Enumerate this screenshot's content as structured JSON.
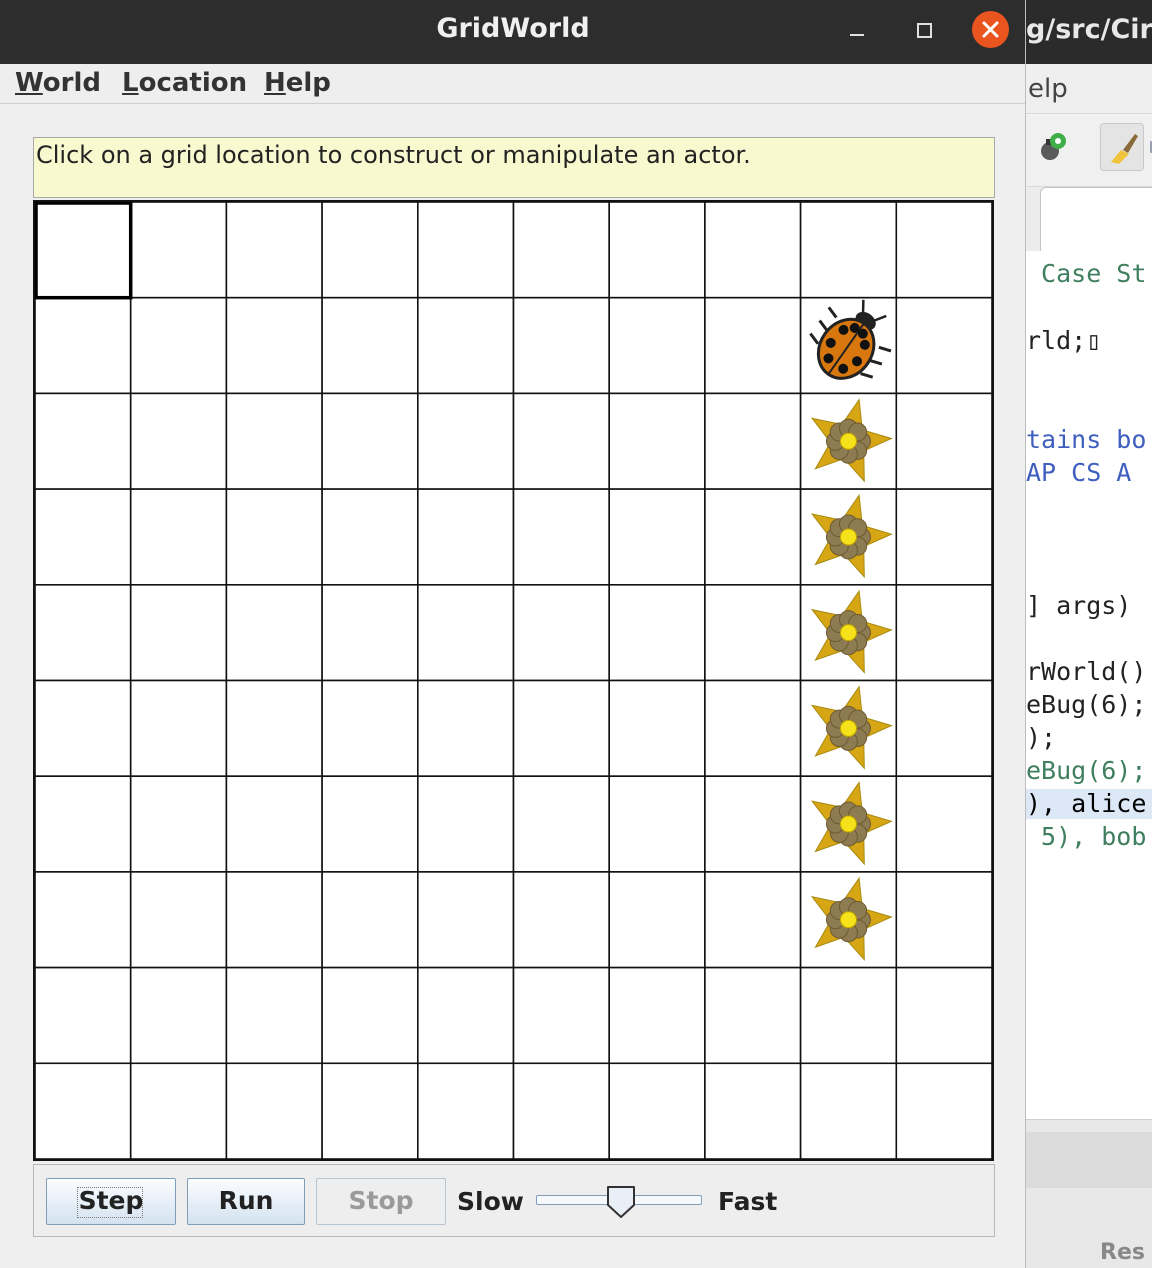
{
  "window": {
    "title": "GridWorld"
  },
  "menu": {
    "world": {
      "mnemonic": "W",
      "rest": "orld"
    },
    "location": {
      "mnemonic": "L",
      "rest": "ocation"
    },
    "help": {
      "mnemonic": "H",
      "rest": "elp"
    }
  },
  "message": "Click on a grid location to construct or manipulate an actor.",
  "grid": {
    "rows": 10,
    "cols": 10,
    "selected": {
      "row": 0,
      "col": 0
    },
    "actors": [
      {
        "type": "bug",
        "icon": "ladybug-icon",
        "row": 1,
        "col": 8
      },
      {
        "type": "flower",
        "icon": "flower-icon",
        "row": 2,
        "col": 8
      },
      {
        "type": "flower",
        "icon": "flower-icon",
        "row": 3,
        "col": 8
      },
      {
        "type": "flower",
        "icon": "flower-icon",
        "row": 4,
        "col": 8
      },
      {
        "type": "flower",
        "icon": "flower-icon",
        "row": 5,
        "col": 8
      },
      {
        "type": "flower",
        "icon": "flower-icon",
        "row": 6,
        "col": 8
      },
      {
        "type": "flower",
        "icon": "flower-icon",
        "row": 7,
        "col": 8
      }
    ]
  },
  "controls": {
    "step_label": "Step",
    "run_label": "Run",
    "stop_label": "Stop",
    "slow_label": "Slow",
    "fast_label": "Fast",
    "speed_level": 0.5
  },
  "background_editor": {
    "title_fragment": "g/src/Cir",
    "menu_fragment": "elp",
    "code_lines": [
      {
        "text": " Case St",
        "style": "comment"
      },
      {
        "text": "rld;▯",
        "style": "plain"
      },
      {
        "text": "tains bo",
        "style": "doc"
      },
      {
        "text": "AP CS A",
        "style": "doc"
      },
      {
        "text": "] args)",
        "style": "plain"
      },
      {
        "text": "rWorld()",
        "style": "plain"
      },
      {
        "text": "eBug(6);",
        "style": "plain"
      },
      {
        "text": ");",
        "style": "plain"
      },
      {
        "text": "eBug(6);",
        "style": "comment"
      },
      {
        "text": "), alice",
        "style": "sel"
      },
      {
        "text": " 5), bob",
        "style": "comment"
      }
    ],
    "status_fragment": "Res"
  },
  "colors": {
    "titlebar": "#2d2d2d",
    "close": "#e9541f",
    "message_bg": "#f9f9d0",
    "flower_petal": "#d6a614",
    "flower_disk": "#8d7b52",
    "flower_center": "#f5e21a",
    "bug_shell": "#d9770f"
  }
}
